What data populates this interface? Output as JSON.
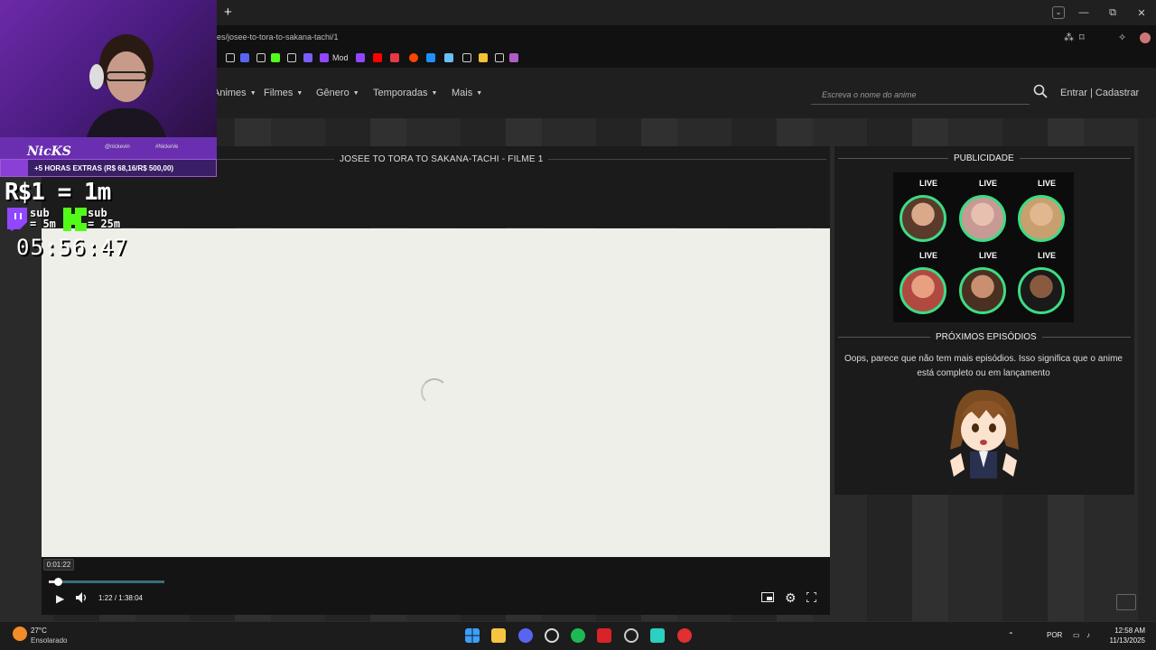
{
  "browser": {
    "new_tab": "+",
    "url": "es/josee-to-tora-to-sakana-tachi/1",
    "bookmark_mod": "Mod",
    "win_min": "—",
    "win_restore": "⧉",
    "win_close": "✕",
    "tab_drop": "⌄"
  },
  "site": {
    "nav": [
      {
        "label": "Animes"
      },
      {
        "label": "Filmes"
      },
      {
        "label": "Gênero"
      },
      {
        "label": "Temporadas"
      },
      {
        "label": "Mais"
      }
    ],
    "search_placeholder": "Escreva o nome do anime",
    "auth": "Entrar | Cadastrar"
  },
  "player": {
    "title": "JOSEE TO TORA TO SAKANA-TACHI - FILME 1",
    "tooltip_time": "0:01:22",
    "current_time": "1:22",
    "separator": "/",
    "duration": "1:38:04",
    "played_fraction": 0.014,
    "buffered_fraction": 0.1
  },
  "sidebar": {
    "ads_title": "PUBLICIDADE",
    "live_label": "LIVE",
    "next_title": "PRÓXIMOS EPISÓDIOS",
    "no_episodes_text": "Oops, parece que não tem mais episódios. Isso significa que o anime está completo ou em lançamento"
  },
  "stream_overlay": {
    "goal_text": "+5 HORAS EXTRAS (R$ 68,16/R$ 500,00)",
    "rate": "R$1 = 1m",
    "twitch_sub": "sub",
    "twitch_sub_value": "= 5m",
    "kick_sub": "sub",
    "kick_sub_value": "= 25m",
    "timer": "05:56:47",
    "sub_strip_1": "@nickevin",
    "sub_strip_2": "#NickeVe"
  },
  "taskbar": {
    "temp": "27°C",
    "weather": "Ensolarado",
    "lang": "POR",
    "time": "12:58 AM",
    "date": "11/13/2025"
  },
  "colors": {
    "live_ring": "#3ddc84",
    "overlay_purple": "#6a2fb0",
    "video_bg": "#efefe9"
  }
}
